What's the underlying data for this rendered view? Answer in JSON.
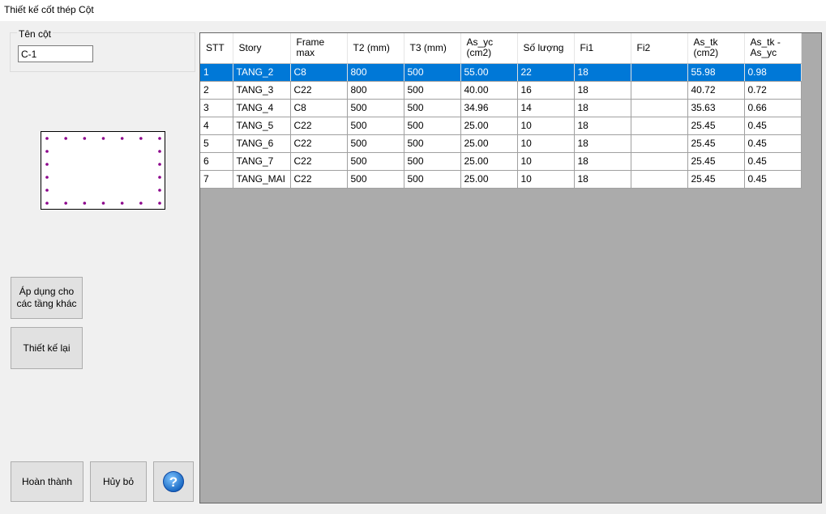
{
  "window": {
    "title": "Thiết kế cốt thép Cột"
  },
  "column_name": {
    "label": "Tên cột",
    "value": "C-1"
  },
  "buttons": {
    "apply": "Áp dụng cho các tầng khác",
    "redesign": "Thiết kế lại",
    "done": "Hoàn thành",
    "cancel": "Hủy bỏ",
    "help_icon": "question-circle-icon"
  },
  "colors": {
    "selection": "#0078d7",
    "grid_background": "#ababab",
    "rebar_dot": "#8b008b"
  },
  "table": {
    "headers": [
      "STT",
      "Story",
      "Frame max",
      "T2 (mm)",
      "T3 (mm)",
      "As_yc (cm2)",
      "Số lượng",
      "Fi1",
      "Fi2",
      "As_tk (cm2)",
      "As_tk - As_yc"
    ],
    "rows": [
      [
        "1",
        "TANG_2",
        "C8",
        "800",
        "500",
        "55.00",
        "22",
        "18",
        "",
        "55.98",
        "0.98"
      ],
      [
        "2",
        "TANG_3",
        "C22",
        "800",
        "500",
        "40.00",
        "16",
        "18",
        "",
        "40.72",
        "0.72"
      ],
      [
        "3",
        "TANG_4",
        "C8",
        "500",
        "500",
        "34.96",
        "14",
        "18",
        "",
        "35.63",
        "0.66"
      ],
      [
        "4",
        "TANG_5",
        "C22",
        "500",
        "500",
        "25.00",
        "10",
        "18",
        "",
        "25.45",
        "0.45"
      ],
      [
        "5",
        "TANG_6",
        "C22",
        "500",
        "500",
        "25.00",
        "10",
        "18",
        "",
        "25.45",
        "0.45"
      ],
      [
        "6",
        "TANG_7",
        "C22",
        "500",
        "500",
        "25.00",
        "10",
        "18",
        "",
        "25.45",
        "0.45"
      ],
      [
        "7",
        "TANG_MAI",
        "C22",
        "500",
        "500",
        "25.00",
        "10",
        "18",
        "",
        "25.45",
        "0.45"
      ]
    ],
    "selected_row": 0
  }
}
